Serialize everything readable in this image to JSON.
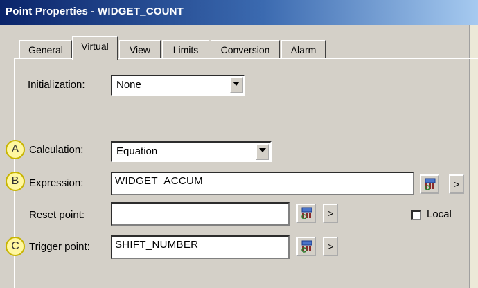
{
  "window": {
    "title": "Point Properties - WIDGET_COUNT"
  },
  "tabs": [
    "General",
    "Virtual",
    "View",
    "Limits",
    "Conversion",
    "Alarm"
  ],
  "active_tab": "Virtual",
  "callouts": [
    "A",
    "B",
    "C"
  ],
  "icons": {
    "more_glyph": ">",
    "browse_icon": "point-browser-icon",
    "dropdown_icon": "chevron-down-icon"
  },
  "fields": {
    "initialization": {
      "label": "Initialization:",
      "value": "None"
    },
    "calculation": {
      "label": "Calculation:",
      "value": "Equation"
    },
    "expression": {
      "label": "Expression:",
      "value": "WIDGET_ACCUM"
    },
    "reset_point": {
      "label": "Reset point:",
      "value": ""
    },
    "trigger_point": {
      "label": "Trigger point:",
      "value": "SHIFT_NUMBER"
    },
    "local": {
      "label": "Local",
      "checked": false
    }
  },
  "colors": {
    "titlebar_start": "#0a246a",
    "titlebar_end": "#a6caf0",
    "dialog_bg": "#d4d0c8",
    "callout_fill": "#fff7a0"
  }
}
